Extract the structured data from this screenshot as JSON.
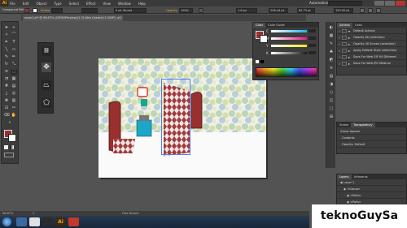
{
  "app": {
    "logo": "Ai",
    "workspace": "Automation"
  },
  "menu": [
    "File",
    "Edit",
    "Object",
    "Type",
    "Select",
    "Effect",
    "View",
    "Window",
    "Help"
  ],
  "control_bar": {
    "selection_type": "Compound Path",
    "stroke_label": "Stroke:",
    "brush": "5 pt. Round",
    "style_label": "Basic",
    "opacity_label": "Opacity:",
    "opacity": "100%",
    "x_value": "1.6 px",
    "y_value": "206.44 pt",
    "w_value": "82.73 pt",
    "h_value": "155.00 pt"
  },
  "document_tab": "room1.ai* @ 96.67% (CMYK/Preview)(1.3) Web Graded (1.000P) .ai1",
  "tools": {
    "items": [
      "selection-icon",
      "direct-selection-icon",
      "magic-wand-icon",
      "lasso-icon",
      "pen-icon",
      "type-icon",
      "line-icon",
      "rectangle-icon",
      "paintbrush-icon",
      "pencil-icon",
      "rotate-icon",
      "scale-icon",
      "width-icon",
      "free-transform-icon",
      "shape-builder-icon",
      "perspective-icon",
      "mesh-icon",
      "gradient-icon",
      "eyedropper-icon",
      "blend-icon",
      "symbol-sprayer-icon",
      "column-graph-icon",
      "artboard-icon",
      "slice-icon",
      "eraser-icon",
      "hand-icon",
      "zoom-icon"
    ],
    "fill_color": "#9a2f31",
    "stroke_color": "#ffffff"
  },
  "free_transform_tools": [
    "constrain-icon",
    "free-transform-icon",
    "perspective-distort-icon",
    "free-distort-icon"
  ],
  "color_panel": {
    "tabs": [
      "Color",
      "Color Guide"
    ],
    "channels": [
      {
        "label": "C",
        "value": "",
        "color": "#19b5e8"
      },
      {
        "label": "M",
        "value": "",
        "color": "#e8197b"
      },
      {
        "label": "Y",
        "value": "",
        "color": "#f2e61a"
      },
      {
        "label": "K",
        "value": "",
        "color": "#1a1a1a"
      }
    ]
  },
  "actions_panel": {
    "tabs": [
      "Actions",
      "Links"
    ],
    "rows": [
      {
        "label": "Default Actions",
        "type": "folder"
      },
      {
        "label": "Opacity 60 (selection)",
        "type": "action"
      },
      {
        "label": "Opacity 40 Screen (selection)",
        "type": "action"
      },
      {
        "label": "Apply Default Style (selection)",
        "type": "action"
      },
      {
        "label": "Save For Web GIF 64 Dithered",
        "type": "action"
      },
      {
        "label": "Save For Web JPG Medium",
        "type": "action"
      }
    ]
  },
  "transparency_panel": {
    "tabs": [
      "Stroke",
      "Transparency"
    ],
    "opacity_label": "Opacity:",
    "opacity_value": "100%",
    "rows": [
      "Group Appear",
      "Contents",
      "Opacity: Default"
    ]
  },
  "layers_panel": {
    "tabs": [
      "Layers",
      "Artboards"
    ],
    "rows": [
      "Layer 1",
      "<Group>",
      "<Path>",
      "<Path>"
    ]
  },
  "status": {
    "zoom": "96.67%",
    "page": "1",
    "tool": "Free Distort"
  },
  "watermark": "teknoGuySa"
}
